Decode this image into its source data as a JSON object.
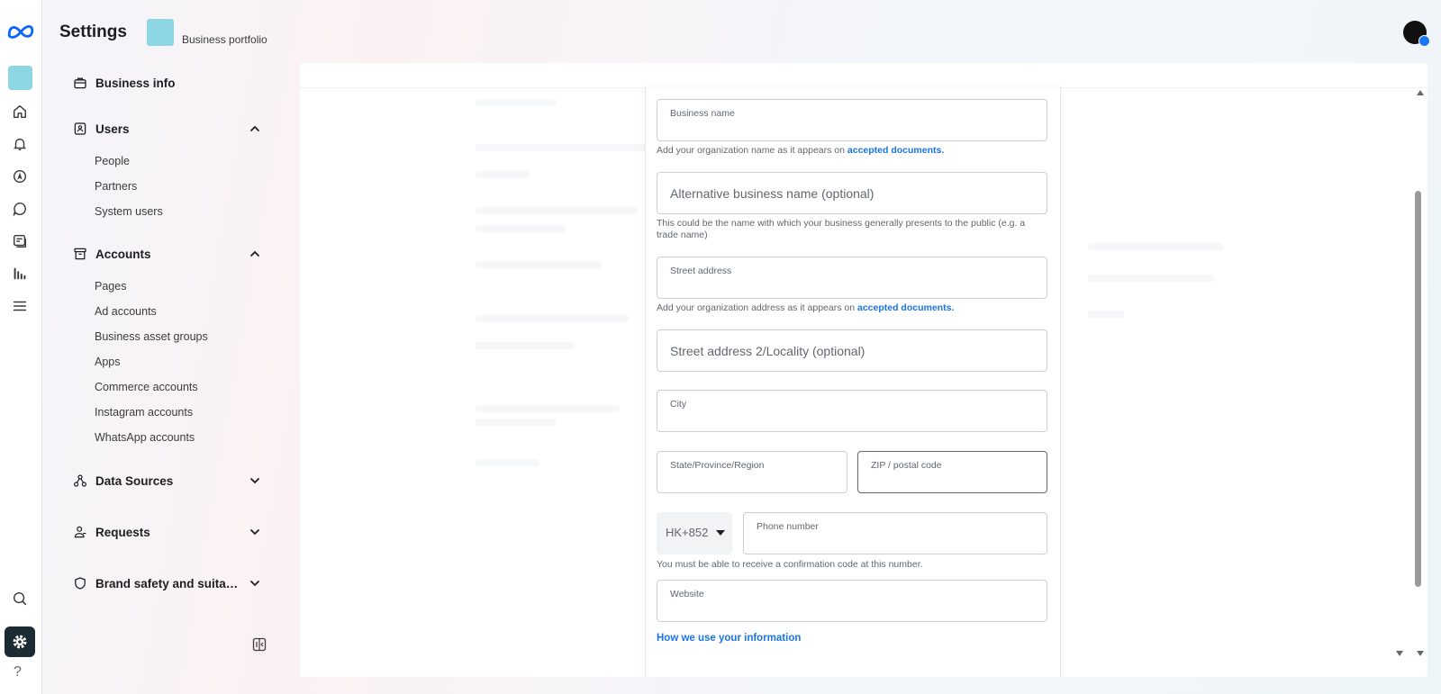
{
  "header": {
    "title": "Settings",
    "portfolio_label": "Business portfolio"
  },
  "rail": {
    "icons": [
      "meta-logo",
      "business-square",
      "home-icon",
      "bell-icon",
      "compass-icon",
      "chat-icon",
      "pages-icon",
      "chart-icon",
      "menu-icon",
      "search-icon",
      "gear-icon",
      "help-icon"
    ],
    "help_glyph": "?"
  },
  "sidebar": {
    "business_info": "Business info",
    "users": {
      "label": "Users",
      "items": [
        "People",
        "Partners",
        "System users"
      ]
    },
    "accounts": {
      "label": "Accounts",
      "items": [
        "Pages",
        "Ad accounts",
        "Business asset groups",
        "Apps",
        "Commerce accounts",
        "Instagram accounts",
        "WhatsApp accounts"
      ]
    },
    "data_sources": "Data Sources",
    "requests": "Requests",
    "brand_safety": "Brand safety and suitabi..."
  },
  "form": {
    "business_name_label": "Business name",
    "business_name_help": "Add your organization name as it appears on ",
    "accepted_documents": "accepted documents.",
    "alt_name_placeholder": "Alternative business name (optional)",
    "alt_name_help": "This could be the name with which your business generally presents to the public (e.g. a trade name)",
    "street_label": "Street address",
    "street_help": "Add your organization address as it appears on ",
    "street2_placeholder": "Street address 2/Locality (optional)",
    "city_label": "City",
    "state_label": "State/Province/Region",
    "zip_label": "ZIP / postal code",
    "country_code": "HK+852",
    "phone_label": "Phone number",
    "phone_help": "You must be able to receive a confirmation code at this number.",
    "website_label": "Website",
    "how_link": "How we use your information"
  },
  "colors": {
    "accent": "#1b74e4",
    "portfolio": "#8dd6e3",
    "active_rail": "#1c2b33"
  }
}
